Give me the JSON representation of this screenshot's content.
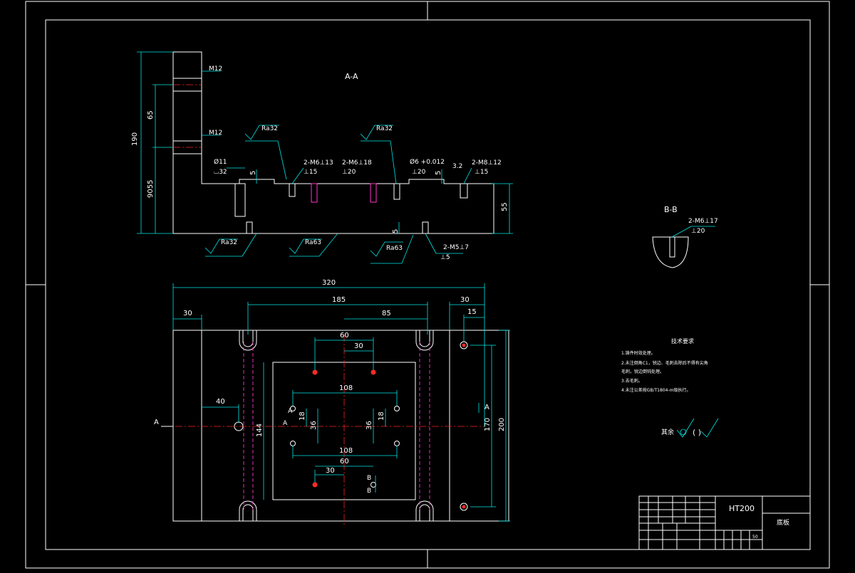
{
  "drawing": {
    "section_aa_label": "A-A",
    "section_bb_label": "B-B",
    "material": "HT200",
    "part_name": "底板",
    "scale_mark": "50"
  },
  "top_view_dims": {
    "d190": "190",
    "d65": "65",
    "d9055": "9055",
    "d55": "55",
    "d5a": "5",
    "d5b": "5",
    "d5c": "5",
    "d32": "3.2"
  },
  "top_view_callouts": {
    "m12_top": "M12",
    "m12_mid": "M12",
    "phi11": "Ø11",
    "phi11_depth": "⌴32",
    "m6_13": "2-M6⊥13",
    "m6_13_sub": "⊥15",
    "m6_18": "2-M6⊥18",
    "m6_18_sub": "⊥20",
    "phi6": "Ø6 +0.012",
    "phi6_sub": "⊥20",
    "m8_12": "2-M8⊥12",
    "m8_12_sub": "⊥15",
    "m5_7": "2-M5⊥7",
    "m5_7_sub": "⊥5",
    "ra32_a": "Ra32",
    "ra32_b": "Ra32",
    "ra32_c": "Ra32",
    "ra63_a": "Ra63",
    "ra63_b": "Ra63"
  },
  "section_bb": {
    "callout": "2-M6⊥17",
    "callout_sub": "⊥20"
  },
  "plan_view_dims": {
    "d320": "320",
    "d185": "185",
    "d85": "85",
    "d30_left": "30",
    "d30_right": "30",
    "d15": "15",
    "d60_top": "60",
    "d30_top": "30",
    "d108_top": "108",
    "d108_bot": "108",
    "d60_bot": "60",
    "d30_bot": "30",
    "d40": "40",
    "d18_left": "18",
    "d36_left": "36",
    "d36_right": "36",
    "d18_right": "18",
    "d144": "144",
    "d170": "170",
    "d200": "200"
  },
  "plan_view_markers": {
    "a_left": "A",
    "a_right": "A",
    "a_inner_left": "A",
    "a_inner_left2": "A",
    "b_top": "B",
    "b_bot": "B"
  },
  "tech_requirements": {
    "title": "技术要求",
    "lines": [
      "1.铸件时效处理。",
      "2.未注倒角C1，锐边、毛刺去除后不得有尖角",
      "毛刺，锐边倒钝处理。",
      "3.去毛刺。",
      "4.未注公差按GB/T1804-m级执行。"
    ]
  },
  "roughness_note": {
    "label": "其余",
    "paren": "( )"
  },
  "title_block": {
    "material": "HT200",
    "name": "底板",
    "scale": "50"
  }
}
